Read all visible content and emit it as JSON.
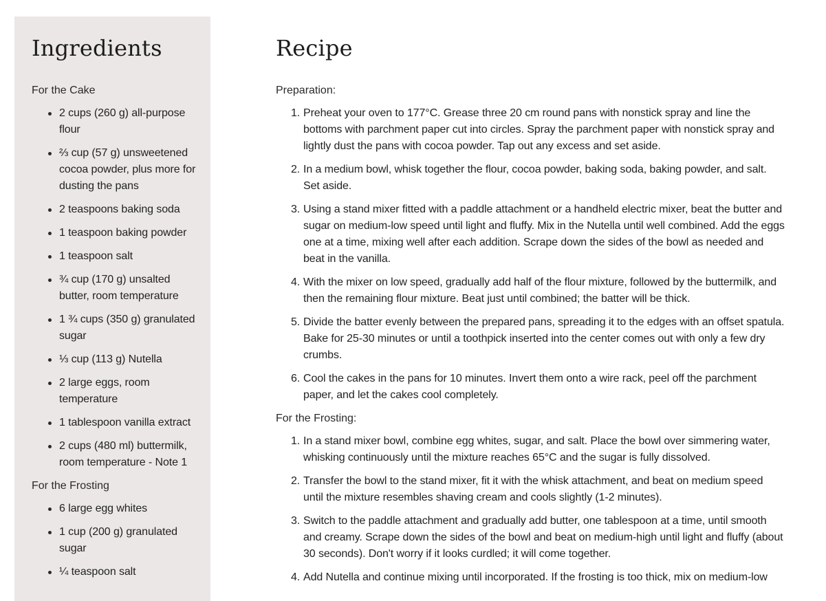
{
  "ingredients": {
    "title": "Ingredients",
    "sections": [
      {
        "label": "For the Cake",
        "items": [
          "2 cups (260 g) all-purpose flour",
          "⅔ cup (57 g) unsweetened cocoa powder, plus more for dusting the pans",
          "2 teaspoons baking soda",
          "1 teaspoon baking powder",
          "1 teaspoon salt",
          "¾ cup (170 g) unsalted butter, room temperature",
          "1 ¾ cups (350 g) granulated sugar",
          "⅓ cup (113 g) Nutella",
          "2 large eggs, room temperature",
          "1 tablespoon vanilla extract",
          "2 cups (480 ml) buttermilk, room temperature - Note 1"
        ]
      },
      {
        "label": "For the Frosting",
        "items": [
          "6 large egg whites",
          "1 cup (200 g) granulated sugar",
          "¼ teaspoon salt"
        ]
      }
    ]
  },
  "recipe": {
    "title": "Recipe",
    "sections": [
      {
        "label": "Preparation:",
        "steps": [
          "Preheat your oven to 177°C. Grease three 20 cm round pans with nonstick spray and line the bottoms with parchment paper cut into circles. Spray the parchment paper with nonstick spray and lightly dust the pans with cocoa powder. Tap out any excess and set aside.",
          "In a medium bowl, whisk together the flour, cocoa powder, baking soda, baking powder, and salt. Set aside.",
          "Using a stand mixer fitted with a paddle attachment or a handheld electric mixer, beat the butter and sugar on medium-low speed until light and fluffy. Mix in the Nutella until well combined. Add the eggs one at a time, mixing well after each addition. Scrape down the sides of the bowl as needed and beat in the vanilla.",
          "With the mixer on low speed, gradually add half of the flour mixture, followed by the buttermilk, and then the remaining flour mixture. Beat just until combined; the batter will be thick.",
          "Divide the batter evenly between the prepared pans, spreading it to the edges with an offset spatula. Bake for 25-30 minutes or until a toothpick inserted into the center comes out with only a few dry crumbs.",
          "Cool the cakes in the pans for 10 minutes. Invert them onto a wire rack, peel off the parchment paper, and let the cakes cool completely."
        ]
      },
      {
        "label": "For the Frosting:",
        "steps": [
          "In a stand mixer bowl, combine egg whites, sugar, and salt. Place the bowl over simmering water, whisking continuously until the mixture reaches 65°C and the sugar is fully dissolved.",
          "Transfer the bowl to the stand mixer, fit it with the whisk attachment, and beat on medium speed until the mixture resembles shaving cream and cools slightly (1-2 minutes).",
          "Switch to the paddle attachment and gradually add butter, one tablespoon at a time, until smooth and creamy. Scrape down the sides of the bowl and beat on medium-high until light and fluffy (about 30 seconds). Don't worry if it looks curdled; it will come together.",
          "Add Nutella and continue mixing until incorporated. If the frosting is too thick, mix on medium-low"
        ]
      }
    ]
  }
}
